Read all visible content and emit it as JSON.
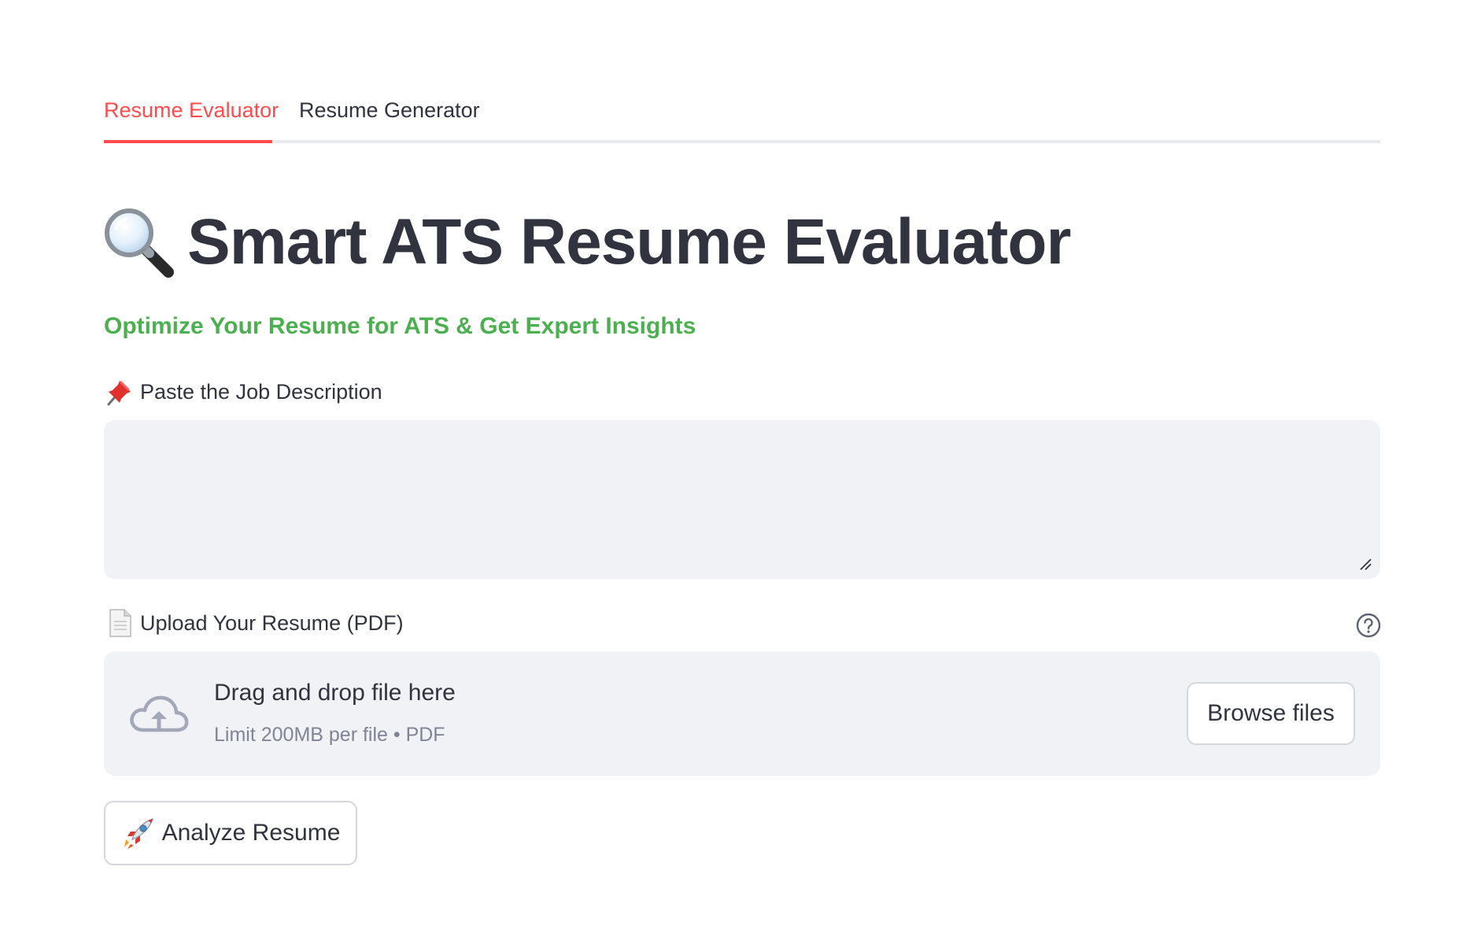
{
  "tabs": [
    {
      "label": "Resume Evaluator",
      "active": true
    },
    {
      "label": "Resume Generator",
      "active": false
    }
  ],
  "header": {
    "title": "Smart ATS Resume Evaluator",
    "title_icon": "magnifying-glass-icon",
    "subtitle": "Optimize Your Resume for ATS & Get Expert Insights"
  },
  "job_description": {
    "label": "Paste the Job Description",
    "label_icon": "pushpin-icon",
    "value": "",
    "placeholder": ""
  },
  "resume_upload": {
    "label": "Upload Your Resume (PDF)",
    "label_icon": "page-icon",
    "help_icon": "help-icon",
    "dropzone_text": "Drag and drop file here",
    "limit_text": "Limit 200MB per file • PDF",
    "browse_label": "Browse files",
    "cloud_icon": "cloud-upload-icon"
  },
  "actions": {
    "analyze_label": "Analyze Resume",
    "analyze_icon": "rocket-icon"
  },
  "colors": {
    "accent": "#ff4b4b",
    "subtitle": "#4caf50",
    "text": "#31333f",
    "input_bg": "#f0f2f6",
    "muted": "#808495"
  }
}
